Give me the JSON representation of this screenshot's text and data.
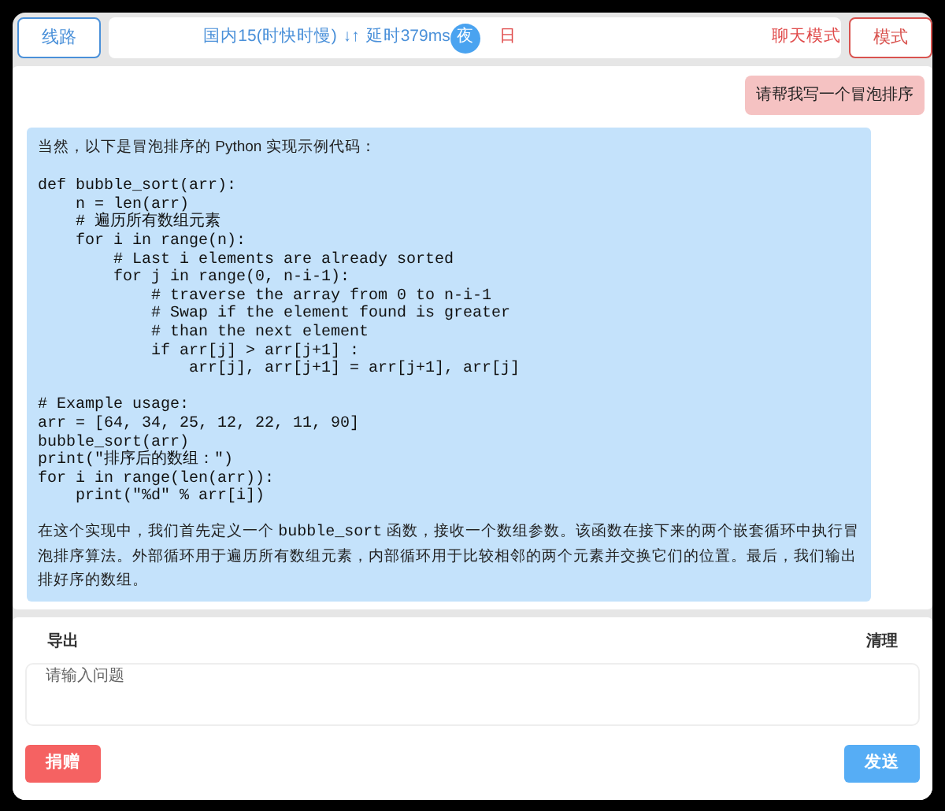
{
  "top_bar": {
    "route_button": "线路",
    "status": {
      "line": "国内15(时快时慢)",
      "arrows": "↓↑",
      "latency": "延时379ms"
    },
    "theme_options": [
      {
        "label": "夜",
        "selected": true
      },
      {
        "label": "日",
        "selected": false
      }
    ],
    "chat_mode": "聊天模式",
    "mode_button": "模式"
  },
  "messages": [
    {
      "kind": "user",
      "text": "请帮我写一个冒泡排序"
    },
    {
      "kind": "assistant",
      "intro": "当然，以下是冒泡排序的 Python 实现示例代码：",
      "code": "def bubble_sort(arr):\n    n = len(arr)\n    # 遍历所有数组元素\n    for i in range(n):\n        # Last i elements are already sorted\n        for j in range(0, n-i-1):\n            # traverse the array from 0 to n-i-1\n            # Swap if the element found is greater\n            # than the next element\n            if arr[j] > arr[j+1] :\n                arr[j], arr[j+1] = arr[j+1], arr[j]\n\n# Example usage:\narr = [64, 34, 25, 12, 22, 11, 90]\nbubble_sort(arr)\nprint(\"排序后的数组：\")\nfor i in range(len(arr)):\n    print(\"%d\" % arr[i])",
      "outro": [
        {
          "kind": "text",
          "text": "在这个实现中，我们首先定义一个 "
        },
        {
          "kind": "code",
          "text": "bubble_sort"
        },
        {
          "kind": "text",
          "text": " 函数，接收一个数组参数。该函数在接下来的两个嵌套循环中执行冒泡排序算法。外部循环用于遍历所有数组元素，内部循环用于比较相邻的两个元素并交换它们的位置。最后，我们输出排好序的数组。"
        }
      ]
    }
  ],
  "footer": {
    "export": "导出",
    "clear": "清理",
    "input": {
      "placeholder": "请输入问题"
    },
    "donate_button": "捐赠",
    "send_button": "发送"
  }
}
